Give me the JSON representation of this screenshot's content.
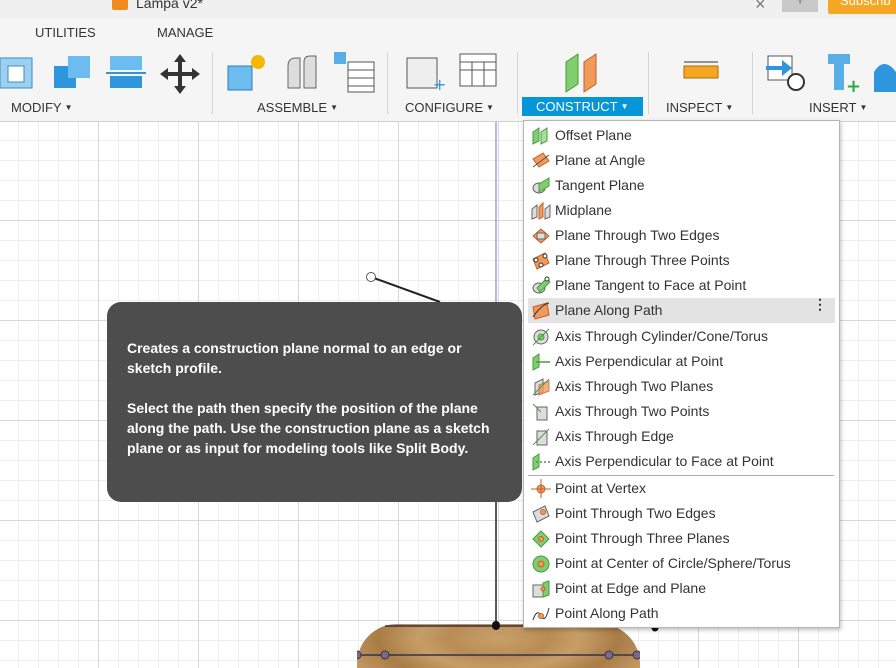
{
  "window": {
    "doc_title": "Lampa v2*",
    "close_tab": "×",
    "new_tab": "+",
    "subscribe_label": "Subscrib"
  },
  "toolbar": {
    "tabs": [
      "UTILITIES",
      "MANAGE"
    ],
    "groups": [
      {
        "label": "MODIFY"
      },
      {
        "label": "ASSEMBLE"
      },
      {
        "label": "CONFIGURE"
      },
      {
        "label": "CONSTRUCT"
      },
      {
        "label": "INSPECT"
      },
      {
        "label": "INSERT"
      }
    ],
    "active_group": "CONSTRUCT",
    "accent_color": "#0696d7"
  },
  "construct_menu": {
    "items": [
      {
        "label": "Offset Plane",
        "icon": "offset-plane-icon"
      },
      {
        "label": "Plane at Angle",
        "icon": "plane-at-angle-icon"
      },
      {
        "label": "Tangent Plane",
        "icon": "tangent-plane-icon"
      },
      {
        "label": "Midplane",
        "icon": "midplane-icon"
      },
      {
        "label": "Plane Through Two Edges",
        "icon": "plane-two-edges-icon"
      },
      {
        "label": "Plane Through Three Points",
        "icon": "plane-three-points-icon"
      },
      {
        "label": "Plane Tangent to Face at Point",
        "icon": "plane-tangent-face-icon"
      },
      {
        "label": "Plane Along Path",
        "icon": "plane-along-path-icon",
        "highlighted": true,
        "more": "⋮"
      },
      {
        "label": "Axis Through Cylinder/Cone/Torus",
        "icon": "axis-cylinder-icon"
      },
      {
        "label": "Axis Perpendicular at Point",
        "icon": "axis-perp-point-icon"
      },
      {
        "label": "Axis Through Two Planes",
        "icon": "axis-two-planes-icon"
      },
      {
        "label": "Axis Through Two Points",
        "icon": "axis-two-points-icon"
      },
      {
        "label": "Axis Through Edge",
        "icon": "axis-edge-icon"
      },
      {
        "label": "Axis Perpendicular to Face at Point",
        "icon": "axis-perp-face-icon"
      },
      {
        "label": "Point at Vertex",
        "icon": "point-vertex-icon"
      },
      {
        "label": "Point Through Two Edges",
        "icon": "point-two-edges-icon"
      },
      {
        "label": "Point Through Three Planes",
        "icon": "point-three-planes-icon"
      },
      {
        "label": "Point at Center of Circle/Sphere/Torus",
        "icon": "point-center-icon"
      },
      {
        "label": "Point at Edge and Plane",
        "icon": "point-edge-plane-icon"
      },
      {
        "label": "Point Along Path",
        "icon": "point-along-path-icon"
      }
    ]
  },
  "tooltip": {
    "line1": "Creates a construction plane normal to an edge or sketch profile.",
    "line2": "Select the path then specify the position of the plane along the path. Use the construction plane as a sketch plane or as input for modeling tools like Split Body."
  }
}
